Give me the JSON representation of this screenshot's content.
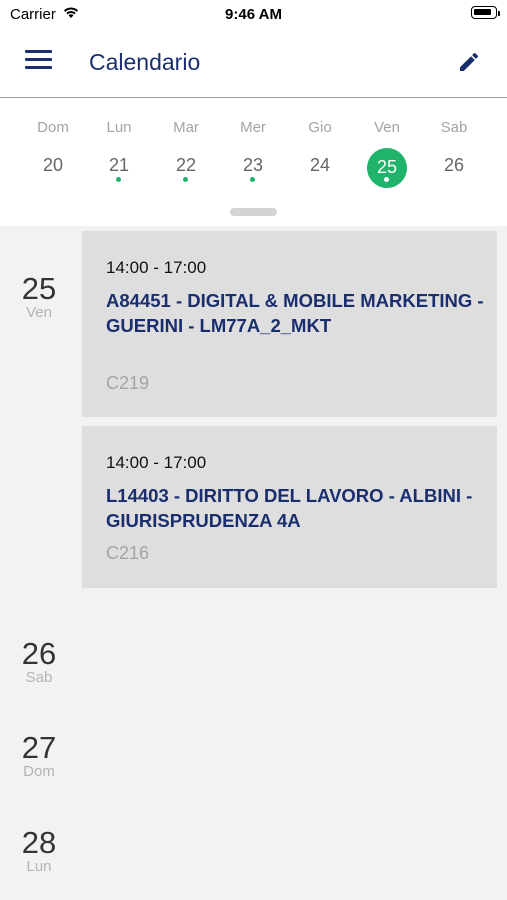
{
  "status": {
    "carrier": "Carrier",
    "time": "9:46 AM"
  },
  "header": {
    "title": "Calendario",
    "menu_icon": "hamburger-menu-icon",
    "edit_icon": "pencil-icon"
  },
  "week": {
    "days": [
      {
        "name": "Dom",
        "number": "20",
        "has_event": false,
        "selected": false
      },
      {
        "name": "Lun",
        "number": "21",
        "has_event": true,
        "selected": false
      },
      {
        "name": "Mar",
        "number": "22",
        "has_event": true,
        "selected": false
      },
      {
        "name": "Mer",
        "number": "23",
        "has_event": true,
        "selected": false
      },
      {
        "name": "Gio",
        "number": "24",
        "has_event": false,
        "selected": false
      },
      {
        "name": "Ven",
        "number": "25",
        "has_event": true,
        "selected": true
      },
      {
        "name": "Sab",
        "number": "26",
        "has_event": false,
        "selected": false
      }
    ]
  },
  "agenda": {
    "dates": [
      {
        "number": "25",
        "day": "Ven"
      },
      {
        "number": "26",
        "day": "Sab"
      },
      {
        "number": "27",
        "day": "Dom"
      },
      {
        "number": "28",
        "day": "Lun"
      }
    ],
    "events": [
      {
        "time": "14:00 - 17:00",
        "title": "A84451 - DIGITAL & MOBILE MARKETING - GUERINI - LM77A_2_MKT",
        "room": "C219"
      },
      {
        "time": "14:00 - 17:00",
        "title": "L14403 - DIRITTO DEL LAVORO - ALBINI - GIURISPRUDENZA  4A",
        "room": "C216"
      }
    ]
  },
  "colors": {
    "accent": "#1fb36b",
    "title_blue": "#1a2e6e",
    "card_bg": "#dedede"
  }
}
